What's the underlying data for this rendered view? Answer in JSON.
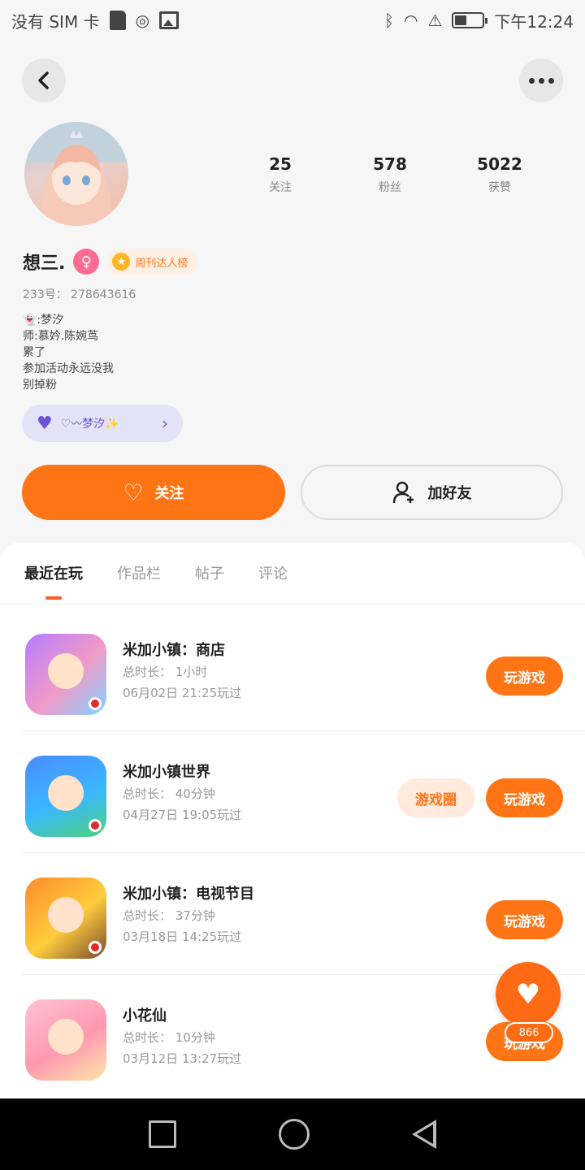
{
  "status_bar": {
    "carrier": "没有 SIM 卡",
    "time": "下午12:24"
  },
  "profile": {
    "stats": [
      {
        "value": "25",
        "label": "关注"
      },
      {
        "value": "578",
        "label": "粉丝"
      },
      {
        "value": "5022",
        "label": "获赞"
      }
    ],
    "name": "想三.",
    "gender_symbol": "♀",
    "badge": "周刊达人榜",
    "uid": "233号： 278643616",
    "bio": [
      "👻:梦汐",
      "师:慕妗.陈婉茑",
      "累了",
      "参加活动永远没我",
      "别掉粉"
    ],
    "club_label": "♡〰梦汐✨",
    "follow_label": "关注",
    "add_friend_label": "加好友"
  },
  "tabs": [
    {
      "label": "最近在玩",
      "active": true
    },
    {
      "label": "作品栏",
      "active": false
    },
    {
      "label": "帖子",
      "active": false
    },
    {
      "label": "评论",
      "active": false
    }
  ],
  "games": [
    {
      "title": "米加小镇：商店",
      "duration": "总时长： 1小时",
      "last_played": "06月02日 21:25玩过",
      "play_label": "玩游戏",
      "circle_label": ""
    },
    {
      "title": "米加小镇世界",
      "duration": "总时长： 40分钟",
      "last_played": "04月27日 19:05玩过",
      "play_label": "玩游戏",
      "circle_label": "游戏圈"
    },
    {
      "title": "米加小镇：电视节目",
      "duration": "总时长： 37分钟",
      "last_played": "03月18日 14:25玩过",
      "play_label": "玩游戏",
      "circle_label": ""
    },
    {
      "title": "小花仙",
      "duration": "总时长： 10分钟",
      "last_played": "03月12日 13:27玩过",
      "play_label": "玩游戏",
      "circle_label": ""
    }
  ],
  "fab": {
    "count": "866"
  },
  "colors": {
    "accent": "#ff7415",
    "club_bg": "#e4e2f7",
    "gender": "#ff6b93"
  }
}
